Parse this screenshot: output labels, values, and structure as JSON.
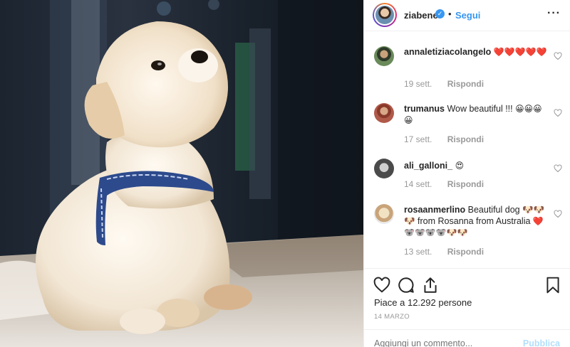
{
  "post": {
    "username": "ziabene",
    "verified_icon": "check-icon",
    "separator": "•",
    "follow_label": "Segui",
    "more_icon": "···",
    "photo_alt": "dog-photo"
  },
  "comments": [
    {
      "user": "annaletiziacolangelo",
      "text": "",
      "emoji": "❤️❤️❤️❤️❤️",
      "time": "19 sett.",
      "reply": "Rispondi"
    },
    {
      "user": "trumanus",
      "text": "Wow beautiful !!!",
      "emoji": "😀😀😀😀",
      "time": "17 sett.",
      "reply": "Rispondi"
    },
    {
      "user": "ali_galloni_",
      "text": "",
      "emoji": "😍",
      "time": "14 sett.",
      "reply": "Rispondi"
    },
    {
      "user": "rosaanmerlino",
      "text": "Beautiful dog 🐶🐶🐶 from Rosanna from Australia",
      "emoji": "❤️🐨🐨🐨🐨🐶🐶",
      "time": "13 sett.",
      "reply": "Rispondi"
    }
  ],
  "likes_text": "Piace a 12.292 persone",
  "date": "14 MARZO",
  "add_comment_placeholder": "Aggiungi un commento...",
  "publish_label": "Pubblica",
  "colors": {
    "accent": "#3897f0",
    "muted": "#999999",
    "publish_disabled": "#b2dffc",
    "heart_red": "#ed4956"
  }
}
